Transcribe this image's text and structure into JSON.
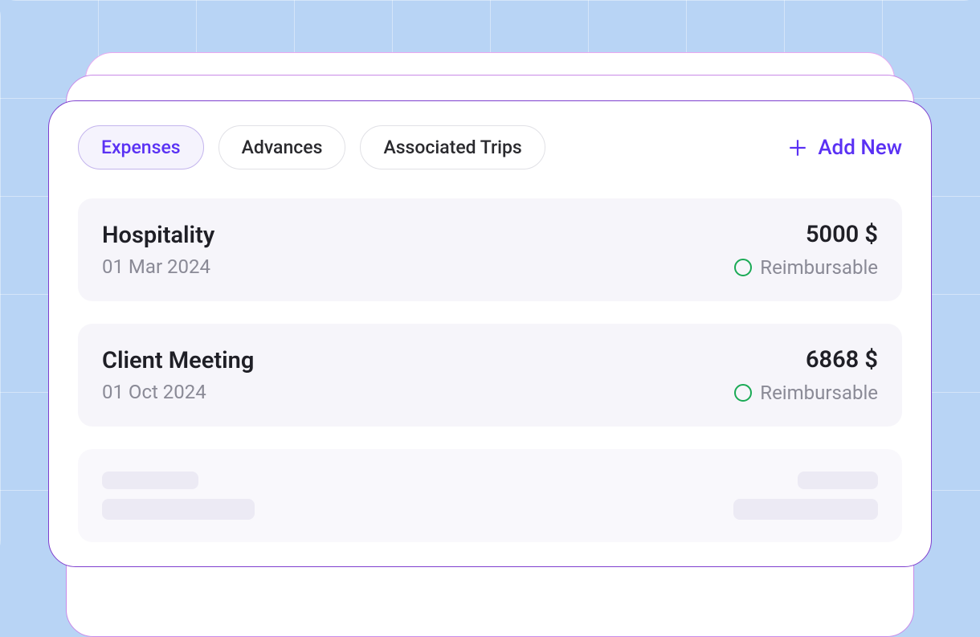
{
  "tabs": [
    {
      "label": "Expenses",
      "active": true
    },
    {
      "label": "Advances",
      "active": false
    },
    {
      "label": "Associated Trips",
      "active": false
    }
  ],
  "add_new_label": "Add New",
  "expenses": [
    {
      "title": "Hospitality",
      "date": "01 Mar 2024",
      "amount": "5000 $",
      "status": "Reimbursable"
    },
    {
      "title": "Client Meeting",
      "date": "01 Oct 2024",
      "amount": "6868 $",
      "status": "Reimbursable"
    }
  ]
}
